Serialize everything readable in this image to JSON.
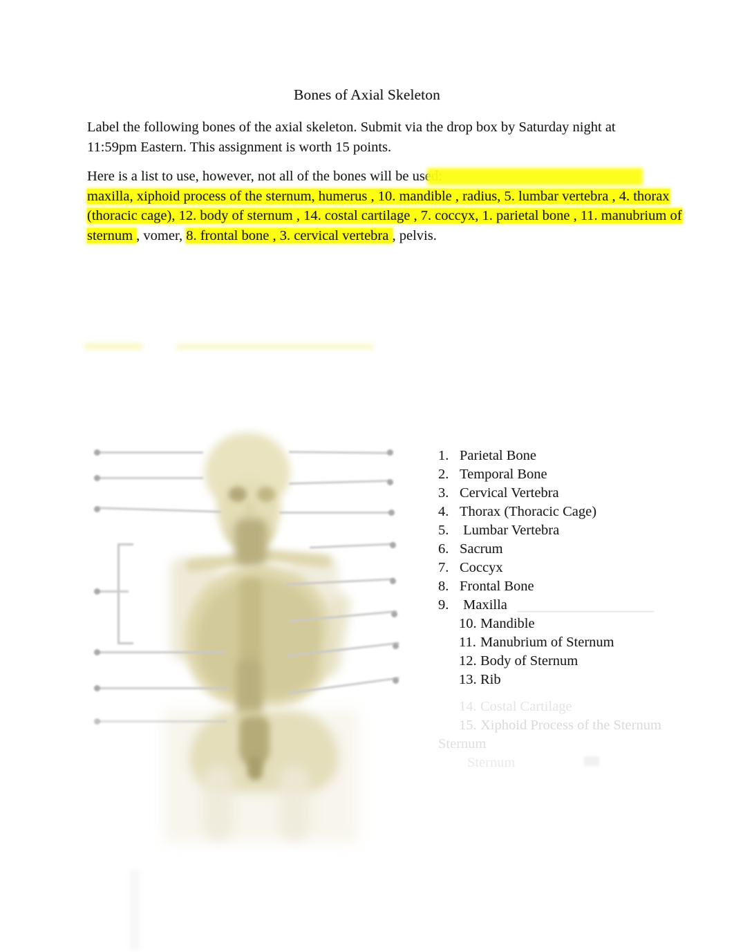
{
  "document": {
    "title": "Bones of Axial Skeleton",
    "intro_paragraph": "Label the following bones of the axial skeleton. Submit via the drop box by Saturday night at 11:59pm Eastern.  This assignment is worth 15 points.",
    "word_bank_intro": "Here is a list to use, however, not all of the bones will be used:",
    "word_bank_line_1": "maxilla, xiphoid process of the sternum, humerus   , 10. mandible , radius, 5. lumbar vertebra  , 4. thorax",
    "word_bank_line_2": "(thoracic cage), 12. body of sternum , 14. costal cartilage , 7. coccyx, 1. parietal bone  , 11. manubrium of",
    "word_bank_line_3": "sternum , vomer, 8.  frontal bone , 3. cervical vertebra  , pelvis.",
    "word_bank_segments": {
      "l1_a": "maxilla, xiphoid process of the sternum, humerus   , 10. mandible , radius, 5. lumbar vertebra  , 4. thorax",
      "l2_a": "(thoracic cage), 12. body of sternum , 14. costal cartilage , 7. coccyx, 1. parietal bone  , 11. manubrium of",
      "l3_a": "sternum ",
      "l3_b": ", vomer, ",
      "l3_c": "8.  frontal bone , 3. cervical vertebra  ",
      "l3_d": ", pelvis."
    },
    "highlight_color": "#fdfd12"
  },
  "answer_list": {
    "items": [
      {
        "num": "1.",
        "label": "Parietal Bone"
      },
      {
        "num": "2.",
        "label": "Temporal Bone"
      },
      {
        "num": "3.",
        "label": "Cervical Vertebra"
      },
      {
        "num": "4.",
        "label": "Thorax (Thoracic Cage)"
      },
      {
        "num": "5.",
        "label": " Lumbar Vertebra"
      },
      {
        "num": "6.",
        "label": "Sacrum"
      },
      {
        "num": "7.",
        "label": "Coccyx"
      },
      {
        "num": "8.",
        "label": "Frontal Bone"
      },
      {
        "num": "9.",
        "label": " Maxilla"
      },
      {
        "num": "10.",
        "label": "Mandible"
      },
      {
        "num": "11.",
        "label": "Manubrium of Sternum"
      },
      {
        "num": "12.",
        "label": "Body of Sternum"
      },
      {
        "num": "13.",
        "label": "Rib"
      },
      {
        "num": "14.",
        "label": "Costal Cartilage"
      },
      {
        "num": "15.",
        "label": "Xiphoid Process of the Sternum"
      }
    ],
    "faint_trailing": {
      "line_a": "Sternum",
      "line_b": "Sternum"
    }
  },
  "figure": {
    "caption": "",
    "alt_name": "axial-skeleton-diagram",
    "leader_line_count_left": 6,
    "leader_line_count_right": 8
  }
}
